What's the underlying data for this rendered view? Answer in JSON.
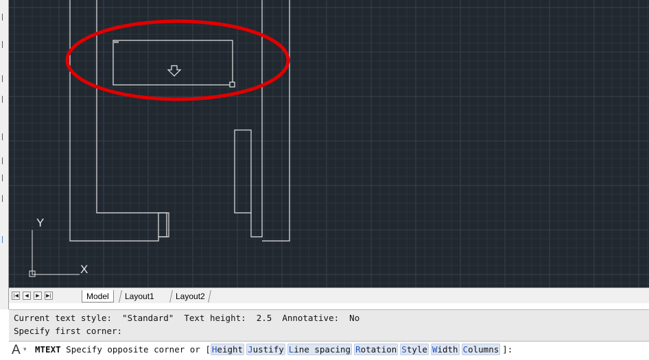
{
  "canvas": {
    "background": "#212830",
    "grid_minor": "#2b333d",
    "grid_major": "#384250",
    "geometry_color": "#e8e8e8",
    "annotation_color": "#e00000",
    "ucs": {
      "y_label": "Y",
      "x_label": "X"
    }
  },
  "tabs": {
    "nav_buttons": [
      "|◀",
      "◀",
      "▶",
      "▶|"
    ],
    "items": [
      {
        "label": "Model",
        "active": true
      },
      {
        "label": "Layout1",
        "active": false
      },
      {
        "label": "Layout2",
        "active": false
      }
    ]
  },
  "history": {
    "line1": "Current text style:  \"Standard\"  Text height:  2.5  Annotative:  No",
    "line2": "Specify first corner:"
  },
  "command": {
    "icon": "A",
    "caret": "▾",
    "name": "MTEXT",
    "prompt": " Specify opposite corner or [",
    "options": [
      {
        "key": "H",
        "rest": "eight"
      },
      {
        "key": "J",
        "rest": "ustify"
      },
      {
        "key": "L",
        "rest": "ine spacing"
      },
      {
        "key": "R",
        "rest": "otation"
      },
      {
        "key": "S",
        "rest": "tyle"
      },
      {
        "key": "W",
        "rest": "idth"
      },
      {
        "key": "C",
        "rest": "olumns"
      }
    ],
    "suffix": "]:"
  }
}
